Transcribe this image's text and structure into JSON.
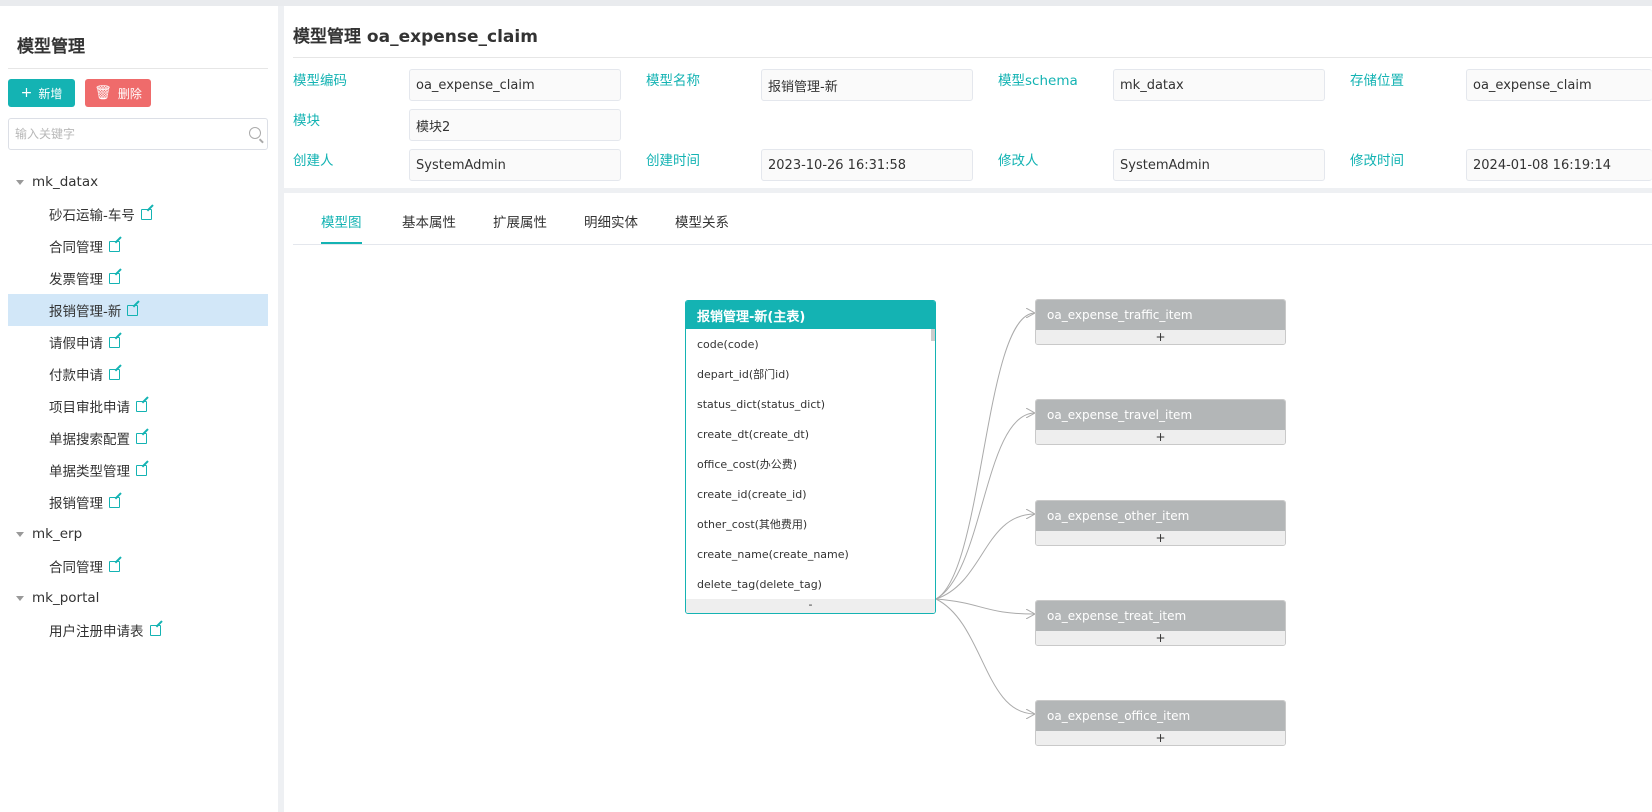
{
  "sidebar": {
    "title": "模型管理",
    "add_label": "新增",
    "delete_label": "删除",
    "search_placeholder": "输入关键字",
    "groups": [
      {
        "name": "mk_datax",
        "items": [
          "砂石运输-车号",
          "合同管理",
          "发票管理",
          "报销管理-新",
          "请假申请",
          "付款申请",
          "项目审批申请",
          "单据搜索配置",
          "单据类型管理",
          "报销管理"
        ]
      },
      {
        "name": "mk_erp",
        "items": [
          "合同管理"
        ]
      },
      {
        "name": "mk_portal",
        "items": [
          "用户注册申请表"
        ]
      }
    ],
    "active_item": "报销管理-新"
  },
  "header": {
    "title": "模型管理 oa_expense_claim",
    "fields": {
      "model_code_label": "模型编码",
      "model_code": "oa_expense_claim",
      "model_name_label": "模型名称",
      "model_name": "报销管理-新",
      "schema_label": "模型schema",
      "schema": "mk_datax",
      "storage_label": "存储位置",
      "storage": "oa_expense_claim",
      "module_label": "模块",
      "module": "模块2",
      "creator_label": "创建人",
      "creator": "SystemAdmin",
      "create_time_label": "创建时间",
      "create_time": "2023-10-26 16:31:58",
      "modifier_label": "修改人",
      "modifier": "SystemAdmin",
      "modify_time_label": "修改时间",
      "modify_time": "2024-01-08 16:19:14"
    }
  },
  "tabs": [
    "模型图",
    "基本属性",
    "扩展属性",
    "明细实体",
    "模型关系"
  ],
  "diagram": {
    "main_table": {
      "title": "报销管理-新(主表)",
      "fields": [
        "code(code)",
        "depart_id(部门id)",
        "status_dict(status_dict)",
        "create_dt(create_dt)",
        "office_cost(办公费)",
        "create_id(create_id)",
        "other_cost(其他费用)",
        "create_name(create_name)",
        "delete_tag(delete_tag)"
      ],
      "collapse_label": "-"
    },
    "sub_tables": [
      {
        "title": "oa_expense_traffic_item",
        "expand_label": "+"
      },
      {
        "title": "oa_expense_travel_item",
        "expand_label": "+"
      },
      {
        "title": "oa_expense_other_item",
        "expand_label": "+"
      },
      {
        "title": "oa_expense_treat_item",
        "expand_label": "+"
      },
      {
        "title": "oa_expense_office_item",
        "expand_label": "+"
      }
    ],
    "colors": {
      "accent": "#14b3b3",
      "sub_header": "#b3b6b7",
      "link": "#aaaaaa"
    }
  }
}
